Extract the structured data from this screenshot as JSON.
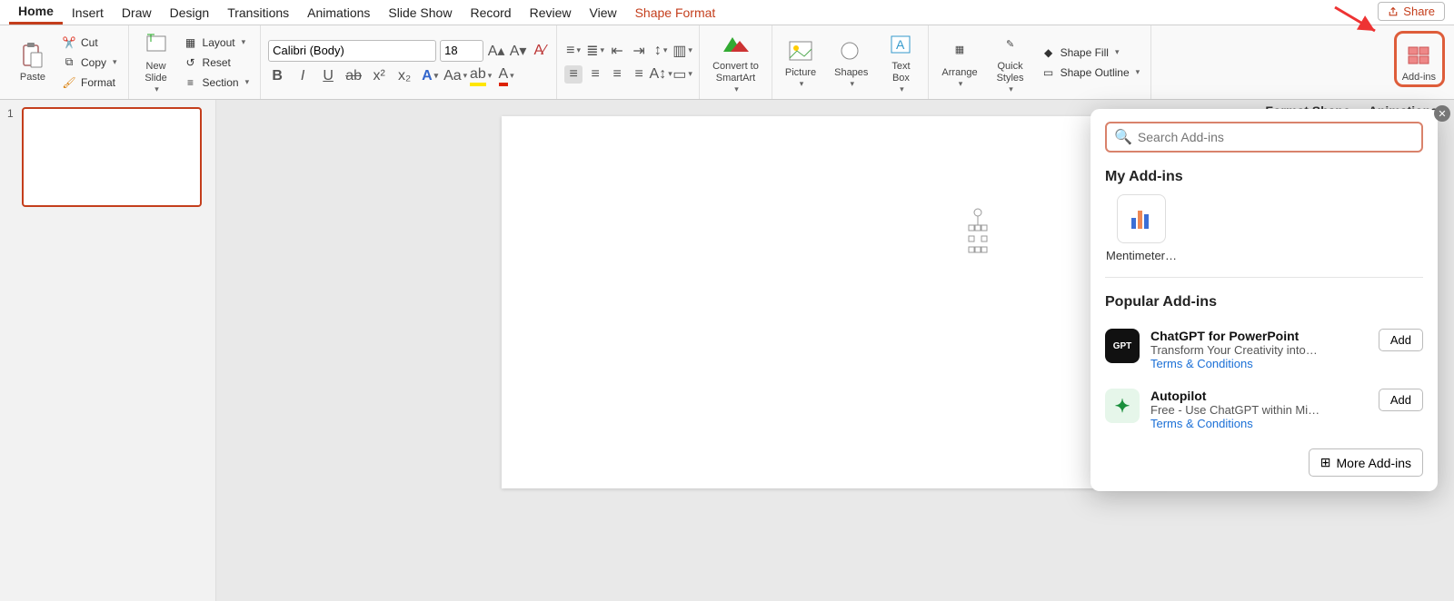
{
  "tabs": [
    "Home",
    "Insert",
    "Draw",
    "Design",
    "Transitions",
    "Animations",
    "Slide Show",
    "Record",
    "Review",
    "View",
    "Shape Format"
  ],
  "activeTab": "Home",
  "share": "Share",
  "clipboard": {
    "paste": "Paste",
    "cut": "Cut",
    "copy": "Copy",
    "format": "Format"
  },
  "slides": {
    "newSlide": "New\nSlide",
    "layout": "Layout",
    "reset": "Reset",
    "section": "Section"
  },
  "font": {
    "name": "Calibri (Body)",
    "size": "18"
  },
  "smartart": "Convert to\nSmartArt",
  "insert": {
    "picture": "Picture",
    "shapes": "Shapes",
    "textbox": "Text\nBox"
  },
  "arrange": {
    "arrange": "Arrange",
    "quick": "Quick\nStyles",
    "fill": "Shape Fill",
    "outline": "Shape Outline"
  },
  "addins": "Add-ins",
  "paneTabs": {
    "format": "Format Shape",
    "anim": "Animations"
  },
  "thumb": {
    "num": "1"
  },
  "popover": {
    "searchPlaceholder": "Search Add-ins",
    "myHeader": "My Add-ins",
    "myItem": "Mentimeter…",
    "popHeader": "Popular Add-ins",
    "items": [
      {
        "title": "ChatGPT for PowerPoint",
        "desc": "Transform Your Creativity into…",
        "link": "Terms & Conditions",
        "logo": "GPT",
        "bg": "#111",
        "fg": "#fff"
      },
      {
        "title": "Autopilot",
        "desc": "Free - Use ChatGPT within Mi…",
        "link": "Terms & Conditions",
        "logo": "✦",
        "bg": "#e6f6ea",
        "fg": "#1a8f3c"
      }
    ],
    "add": "Add",
    "more": "More Add-ins"
  }
}
